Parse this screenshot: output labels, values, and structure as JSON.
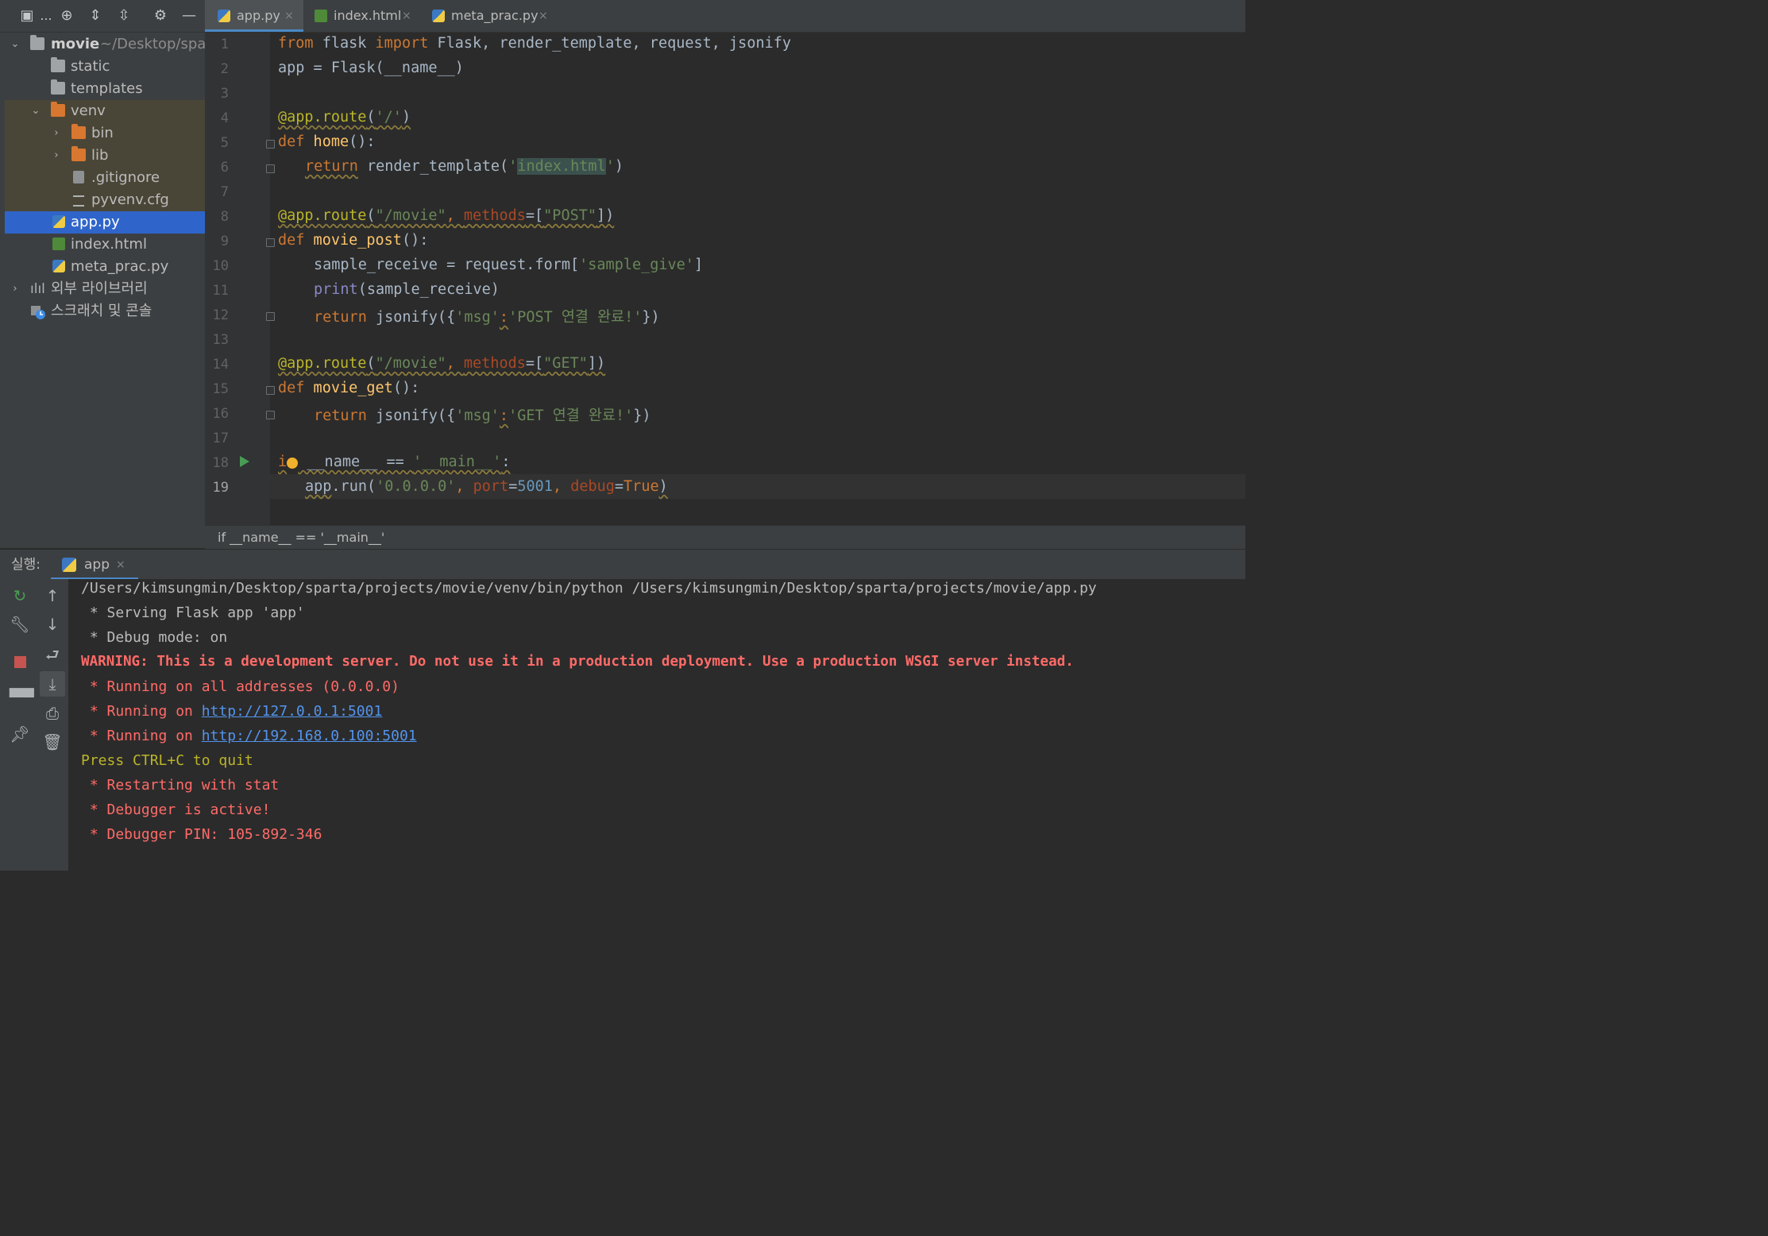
{
  "project": {
    "toolbar_ellipsis": "...",
    "root": {
      "name": "movie",
      "path": "~/Desktop/spar"
    },
    "items": [
      {
        "label": "static"
      },
      {
        "label": "templates"
      },
      {
        "label": "venv"
      },
      {
        "label": "bin"
      },
      {
        "label": "lib"
      },
      {
        "label": ".gitignore"
      },
      {
        "label": "pyvenv.cfg"
      },
      {
        "label": "app.py"
      },
      {
        "label": "index.html"
      },
      {
        "label": "meta_prac.py"
      },
      {
        "label": "외부 라이브러리"
      },
      {
        "label": "스크래치 및 콘솔"
      }
    ]
  },
  "tabs": [
    {
      "label": "app.py",
      "close": "×"
    },
    {
      "label": "index.html",
      "close": "×"
    },
    {
      "label": "meta_prac.py",
      "close": "×"
    }
  ],
  "editor": {
    "line_numbers": [
      "1",
      "2",
      "3",
      "4",
      "5",
      "6",
      "7",
      "8",
      "9",
      "10",
      "11",
      "12",
      "13",
      "14",
      "15",
      "16",
      "17",
      "18",
      "19"
    ],
    "current_line": "19"
  },
  "code": {
    "l1": {
      "from": "from",
      "mod": " flask ",
      "imp": "import",
      "rest": " Flask, render_template, request, jsonify"
    },
    "l2": "app = Flask(__name__)",
    "l4": {
      "deco": "@app.route",
      "open": "(",
      "arg": "'/'",
      "close": ")"
    },
    "l5": {
      "def": "def",
      "name": " home",
      "rest": "():"
    },
    "l6": {
      "ret": "return",
      "call": " render_template(",
      "q1": "'",
      "tpl": "index.html",
      "q2": "'",
      "end": ")"
    },
    "l8": {
      "deco": "@app.route",
      "open": "(",
      "arg": "\"/movie\"",
      "comma": ", ",
      "param": "methods",
      "eq": "=[",
      "val": "\"POST\"",
      "end": "])"
    },
    "l9": {
      "def": "def",
      "name": " movie_post",
      "rest": "():"
    },
    "l10": {
      "lhs": "sample_receive = request.form[",
      "key": "'sample_give'",
      "end": "]"
    },
    "l11": {
      "print": "print",
      "rest": "(sample_receive)"
    },
    "l12": {
      "ret": "return",
      "call": " jsonify({",
      "key": "'msg'",
      "colon": ":",
      "val": "'POST 연결 완료!'",
      "end": "})"
    },
    "l14": {
      "deco": "@app.route",
      "open": "(",
      "arg": "\"/movie\"",
      "comma": ", ",
      "param": "methods",
      "eq": "=[",
      "val": "\"GET\"",
      "end": "])"
    },
    "l15": {
      "def": "def",
      "name": " movie_get",
      "rest": "():"
    },
    "l16": {
      "ret": "return",
      "call": " jsonify({",
      "key": "'msg'",
      "colon": ":",
      "val": "'GET 연결 완료!'",
      "end": "})"
    },
    "l18": {
      "i": "i",
      "name": " __name__ == ",
      "main": "'__main__'",
      "colon": ":"
    },
    "l19": {
      "app": "app",
      "run": ".run(",
      "host": "'0.0.0.0'",
      "comma1": ", ",
      "port_k": "port",
      "eq1": "=",
      "port_v": "5001",
      "comma2": ", ",
      "debug_k": "debug",
      "eq2": "=",
      "debug_v": "True",
      "end": ")"
    }
  },
  "breadcrumb": "if __name__ == '__main__'",
  "run": {
    "title": "실행:",
    "tab": "app",
    "tab_close": "×",
    "console": [
      {
        "text": "/Users/kimsungmin/Desktop/sparta/projects/movie/venv/bin/python /Users/kimsungmin/Desktop/sparta/projects/movie/app.py"
      },
      {
        "text": " * Serving Flask app 'app'"
      },
      {
        "text": " * Debug mode: on"
      },
      {
        "text": "WARNING: This is a development server. Do not use it in a production deployment. Use a production WSGI server instead."
      },
      {
        "text": " * Running on all addresses (0.0.0.0)"
      },
      {
        "prefix": " * Running on ",
        "link": "http://127.0.0.1:5001"
      },
      {
        "prefix": " * Running on ",
        "link": "http://192.168.0.100:5001"
      },
      {
        "text": "Press CTRL+C to quit"
      },
      {
        "text": " * Restarting with stat"
      },
      {
        "text": " * Debugger is active!"
      },
      {
        "text": " * Debugger PIN: 105-892-346"
      }
    ]
  },
  "colors": {
    "keyword": "#cc7832",
    "function": "#ffc66d",
    "string": "#6a8759",
    "number": "#6897bb",
    "decorator": "#bbb529",
    "error": "#ff6b68",
    "link": "#5394ec",
    "selection": "#2f65ca"
  },
  "icons": {
    "project_toolbar": [
      "project-view-icon",
      "locate-icon",
      "expand-all-icon",
      "collapse-all-icon",
      "gear-icon",
      "minimize-icon"
    ],
    "run_toolbar": [
      "rerun-icon",
      "wrench-icon",
      "stop-icon",
      "layout-icon",
      "pin-icon",
      "up-arrow-icon",
      "down-arrow-icon",
      "soft-wrap-icon",
      "scroll-to-end-icon",
      "print-icon",
      "trash-icon"
    ]
  }
}
